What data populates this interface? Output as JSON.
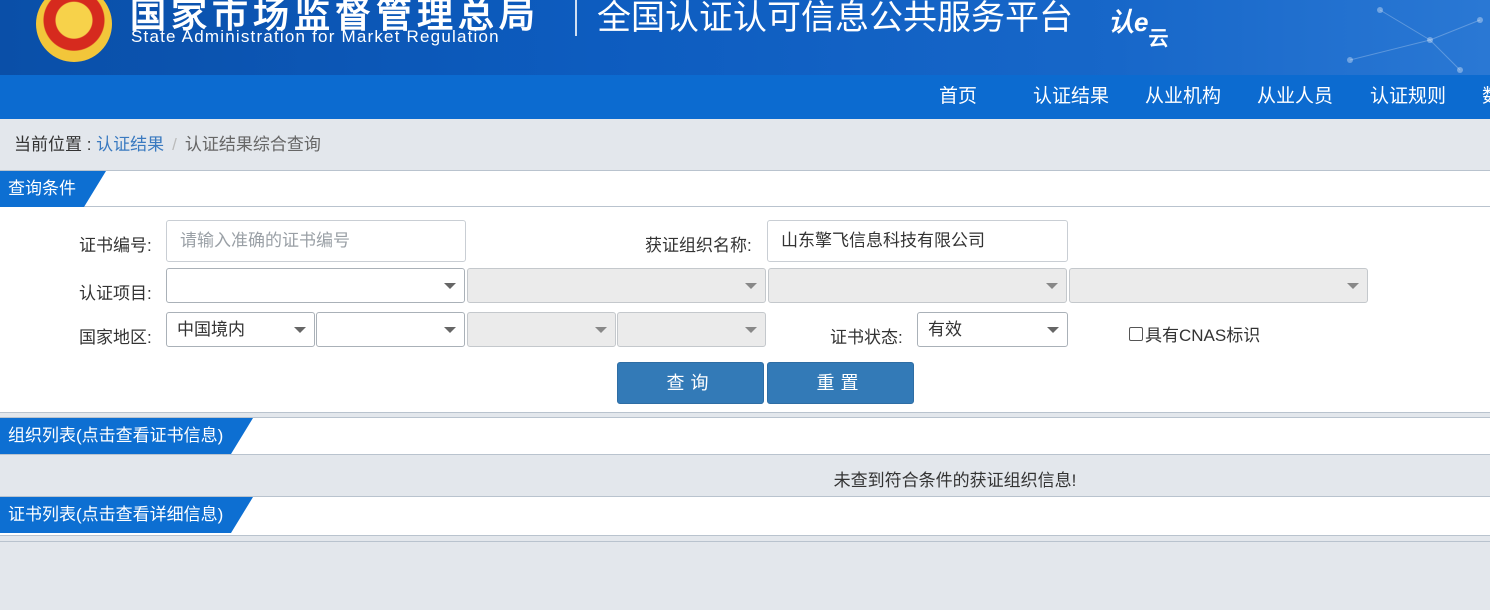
{
  "header": {
    "org_cn": "国家市场监督管理总局",
    "org_en": "State Administration  for  Market Regulation",
    "platform": "全国认证认可信息公共服务平台",
    "logo_text": "认e",
    "logo_sub": "云"
  },
  "nav": {
    "items": [
      "首页",
      "认证结果",
      "从业机构",
      "从业人员",
      "认证规则",
      "数"
    ]
  },
  "breadcrumb": {
    "prefix": "当前位置 : ",
    "link": "认证结果",
    "separator": "/",
    "current": "认证结果综合查询"
  },
  "query": {
    "tab_title": "查询条件",
    "cert_no_label": "证书编号:",
    "cert_no_placeholder": "请输入准确的证书编号",
    "org_name_label": "获证组织名称:",
    "org_name_value": "山东擎飞信息科技有限公司",
    "project_label": "认证项目:",
    "region_label": "国家地区:",
    "region_value": "中国境内",
    "status_label": "证书状态:",
    "status_value": "有效",
    "cnas_label": "具有CNAS标识",
    "search_button": "查询",
    "reset_button": "重置"
  },
  "org_list": {
    "tab_title": "组织列表(点击查看证书信息)",
    "empty_message": "未查到符合条件的获证组织信息!"
  },
  "cert_list": {
    "tab_title": "证书列表(点击查看详细信息)"
  },
  "colors": {
    "nav_bg": "#0c6bd0",
    "tab_bg": "#0d6fd2",
    "button_bg": "#337ab7",
    "page_bg": "#e3e7ec",
    "link": "#3a7ac0"
  }
}
